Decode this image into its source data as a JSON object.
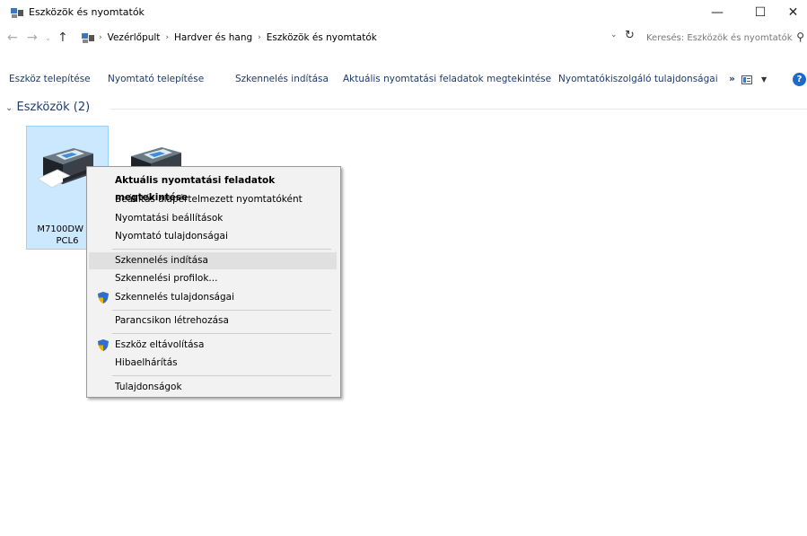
{
  "window": {
    "title": "Eszközök és nyomtatók",
    "controls": {
      "minimize": "—",
      "maximize": "☐",
      "close": "✕"
    }
  },
  "address": {
    "crumbs": [
      "Vezérlőpult",
      "Hardver és hang",
      "Eszközök és nyomtatók"
    ],
    "search_placeholder": "Keresés: Eszközök és nyomtatók"
  },
  "commands": {
    "install_device": "Eszköz telepítése",
    "install_printer": "Nyomtató telepítése",
    "start_scan": "Szkennelés indítása",
    "view_print_jobs": "Aktuális nyomtatási feladatok megtekintése",
    "print_server_props": "Nyomtatókiszolgáló tulajdonságai",
    "more": "»",
    "help": "?"
  },
  "group": {
    "header": "Eszközök (2)"
  },
  "devices": [
    {
      "label_line1": "M7100DW Se",
      "label_line2": "PCL6",
      "selected": true
    },
    {
      "label_line1": "",
      "label_line2": "",
      "selected": false
    }
  ],
  "context_menu": {
    "items": [
      "Aktuális nyomtatási feladatok megtekintése",
      "Beállítás alapértelmezett nyomtatóként",
      "Nyomtatási beállítások",
      "Nyomtató tulajdonságai",
      "Szkennelés indítása",
      "Szkennelési profilok...",
      "Szkennelés tulajdonságai",
      "Parancsikon létrehozása",
      "Eszköz eltávolítása",
      "Hibaelhárítás",
      "Tulajdonságok"
    ]
  },
  "colors": {
    "selection": "#cce8ff",
    "link": "#1e3a6e",
    "help": "#1b6ac9"
  }
}
